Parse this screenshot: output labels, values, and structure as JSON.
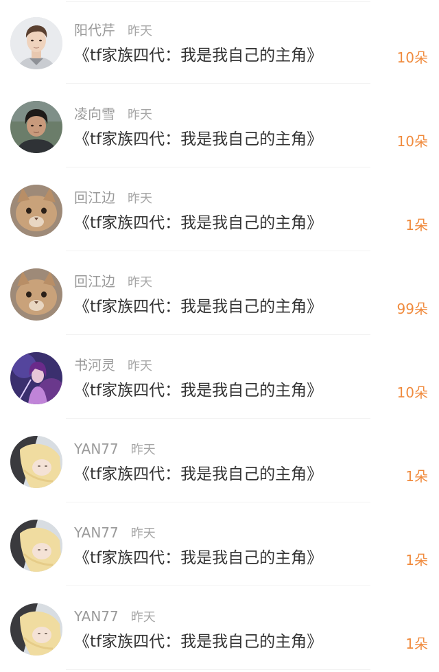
{
  "feed": {
    "items": [
      {
        "user": "阳代芹",
        "time": "昨天",
        "gift": "《tf家族四代：我是我自己的主角》",
        "count": "10朵",
        "avatar": "man-portrait-icon"
      },
      {
        "user": "凌向雪",
        "time": "昨天",
        "gift": "《tf家族四代：我是我自己的主角》",
        "count": "10朵",
        "avatar": "person-photo-icon"
      },
      {
        "user": "回江边",
        "time": "昨天",
        "gift": "《tf家族四代：我是我自己的主角》",
        "count": "1朵",
        "avatar": "cat-icon"
      },
      {
        "user": "回江边",
        "time": "昨天",
        "gift": "《tf家族四代：我是我自己的主角》",
        "count": "99朵",
        "avatar": "cat-icon"
      },
      {
        "user": "书河灵",
        "time": "昨天",
        "gift": "《tf家族四代：我是我自己的主角》",
        "count": "10朵",
        "avatar": "game-character-icon"
      },
      {
        "user": "YAN77",
        "time": "昨天",
        "gift": "《tf家族四代：我是我自己的主角》",
        "count": "1朵",
        "avatar": "anime-girl-icon"
      },
      {
        "user": "YAN77",
        "time": "昨天",
        "gift": "《tf家族四代：我是我自己的主角》",
        "count": "1朵",
        "avatar": "anime-girl-icon"
      },
      {
        "user": "YAN77",
        "time": "昨天",
        "gift": "《tf家族四代：我是我自己的主角》",
        "count": "1朵",
        "avatar": "anime-girl-icon"
      }
    ]
  },
  "colors": {
    "username": "#9a9a9a",
    "time": "#a6a6a6",
    "gift_text": "#333333",
    "count": "#f08a3c",
    "divider": "#f2f2f2"
  }
}
